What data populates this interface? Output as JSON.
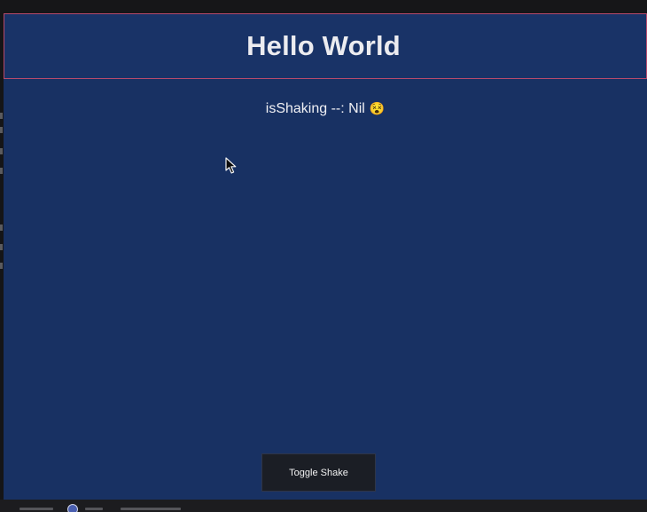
{
  "header": {
    "title": "Hello World"
  },
  "status": {
    "text": "isShaking --: Nil",
    "emoji": "😵"
  },
  "controls": {
    "toggle_label": "Toggle Shake"
  },
  "colors": {
    "app_background": "#183163",
    "header_border": "#b64a6c",
    "button_background": "#1b1e25",
    "text": "#ececf0"
  },
  "icons": {
    "cursor": "mouse-pointer-icon",
    "taskbar": "app-dot-icon"
  }
}
